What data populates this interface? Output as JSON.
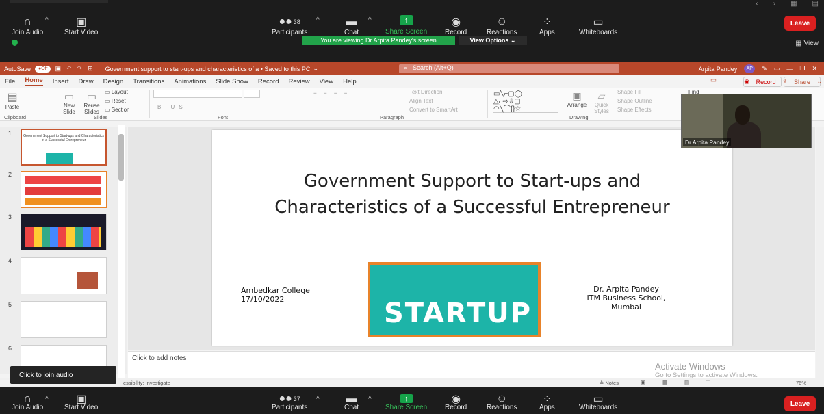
{
  "zoom_top": {
    "join_audio": "Join Audio",
    "start_video": "Start Video",
    "participants_label": "Participants",
    "participants_count": "38",
    "chat": "Chat",
    "share_screen": "Share Screen",
    "record": "Record",
    "reactions": "Reactions",
    "apps": "Apps",
    "whiteboards": "Whiteboards",
    "leave": "Leave",
    "viewing_banner": "You are viewing Dr Arpita Pandey's screen",
    "view_options": "View Options",
    "view": "View"
  },
  "ppt": {
    "autosave": "AutoSave",
    "autosave_state": "Off",
    "doc_title": "Government support to start-ups and characteristics of a  •  Saved to this PC",
    "search_placeholder": "Search (Alt+Q)",
    "user_name": "Arpita  Pandey",
    "user_initials": "AP",
    "menu": [
      "File",
      "Home",
      "Insert",
      "Draw",
      "Design",
      "Transitions",
      "Animations",
      "Slide Show",
      "Record",
      "Review",
      "View",
      "Help"
    ],
    "record_btn": "Record",
    "share_btn": "Share",
    "ribbon": {
      "paste": "Paste",
      "new_slide": "New Slide",
      "reuse_slides": "Reuse Slides",
      "layout": "Layout",
      "reset": "Reset",
      "section": "Section",
      "clipboard": "Clipboard",
      "slides": "Slides",
      "font": "Font",
      "paragraph": "Paragraph",
      "text_direction": "Text Direction",
      "align_text": "Align Text",
      "convert_smartart": "Convert to SmartArt",
      "arrange": "Arrange",
      "quick_styles": "Quick Styles",
      "shape_fill": "Shape Fill",
      "shape_outline": "Shape Outline",
      "shape_effects": "Shape Effects",
      "drawing": "Drawing",
      "find": "Find"
    },
    "slide_numbers": [
      "1",
      "2",
      "3",
      "4",
      "5",
      "6"
    ],
    "slide": {
      "title": "Government Support to Start-ups and Characteristics of a Successful Entrepreneur",
      "left_line1": "Ambedkar College",
      "left_line2": "17/10/2022",
      "right_line1": "Dr. Arpita Pandey",
      "right_line2": "ITM Business School,",
      "right_line3": "Mumbai",
      "image_word": "STARTUP"
    },
    "notes_placeholder": "Click to add notes",
    "status_left": "essibility: Investigate",
    "status_notes": "Notes",
    "status_zoom": "76%",
    "activate_title": "Activate Windows",
    "activate_sub": "Go to Settings to activate Windows."
  },
  "video": {
    "name": "Dr Arpita Pandey"
  },
  "tooltip": "Click to join audio",
  "zoom_bottom": {
    "join_audio": "Join Audio",
    "start_video": "Start Video",
    "participants_label": "Participants",
    "participants_count": "37",
    "chat": "Chat",
    "share_screen": "Share Screen",
    "record": "Record",
    "reactions": "Reactions",
    "apps": "Apps",
    "whiteboards": "Whiteboards",
    "leave": "Leave"
  },
  "colors": {
    "zoom_bg": "#1c1c1c",
    "ppt_accent": "#b7472a",
    "share_green": "#16a34a",
    "leave_red": "#d92020"
  }
}
